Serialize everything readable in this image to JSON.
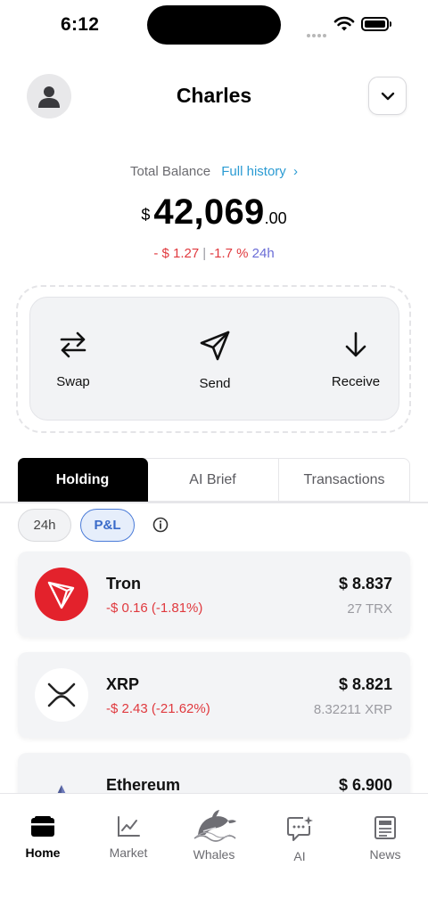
{
  "status_bar": {
    "time": "6:12"
  },
  "header": {
    "user_name": "Charles"
  },
  "balance": {
    "label": "Total Balance",
    "history_link": "Full history",
    "currency": "$",
    "integer": "42,069",
    "decimal": ".00",
    "change_amount": "- $ 1.27",
    "separator": "|",
    "change_percent": "-1.7 %",
    "change_period": "24h"
  },
  "actions": [
    {
      "label": "Swap",
      "icon": "swap-arrows-icon"
    },
    {
      "label": "Send",
      "icon": "send-icon"
    },
    {
      "label": "Receive",
      "icon": "download-arrow-icon"
    }
  ],
  "tabs": [
    {
      "label": "Holding",
      "active": true
    },
    {
      "label": "AI Brief",
      "active": false
    },
    {
      "label": "Transactions",
      "active": false
    }
  ],
  "filters": [
    {
      "label": "24h",
      "selected": false
    },
    {
      "label": "P&L",
      "selected": true
    }
  ],
  "assets": [
    {
      "name": "Tron",
      "change": "-$ 0.16 (-1.81%)",
      "value": "$ 8.837",
      "amount": "27 TRX",
      "logo_color": "#e3222c",
      "icon": "tron-logo-icon"
    },
    {
      "name": "XRP",
      "change": "-$ 2.43 (-21.62%)",
      "value": "$ 8.821",
      "amount": "8.32211 XRP",
      "logo_color": "#ffffff",
      "icon": "xrp-logo-icon"
    },
    {
      "name": "Ethereum",
      "change": "",
      "value": "$ 6.900",
      "amount": "",
      "logo_color": "#5c6aa8",
      "icon": "ethereum-logo-icon"
    }
  ],
  "bottom_nav": [
    {
      "label": "Home",
      "icon": "wallet-icon",
      "active": true
    },
    {
      "label": "Market",
      "icon": "chart-icon",
      "active": false
    },
    {
      "label": "Whales",
      "icon": "whale-icon",
      "active": false
    },
    {
      "label": "AI",
      "icon": "chat-sparkle-icon",
      "active": false
    },
    {
      "label": "News",
      "icon": "newspaper-icon",
      "active": false
    }
  ],
  "colors": {
    "accent_blue": "#2b9bd3",
    "negative_red": "#e0393e",
    "period_purple": "#6a6cd6",
    "chip_selected_border": "#4a7bd8"
  }
}
